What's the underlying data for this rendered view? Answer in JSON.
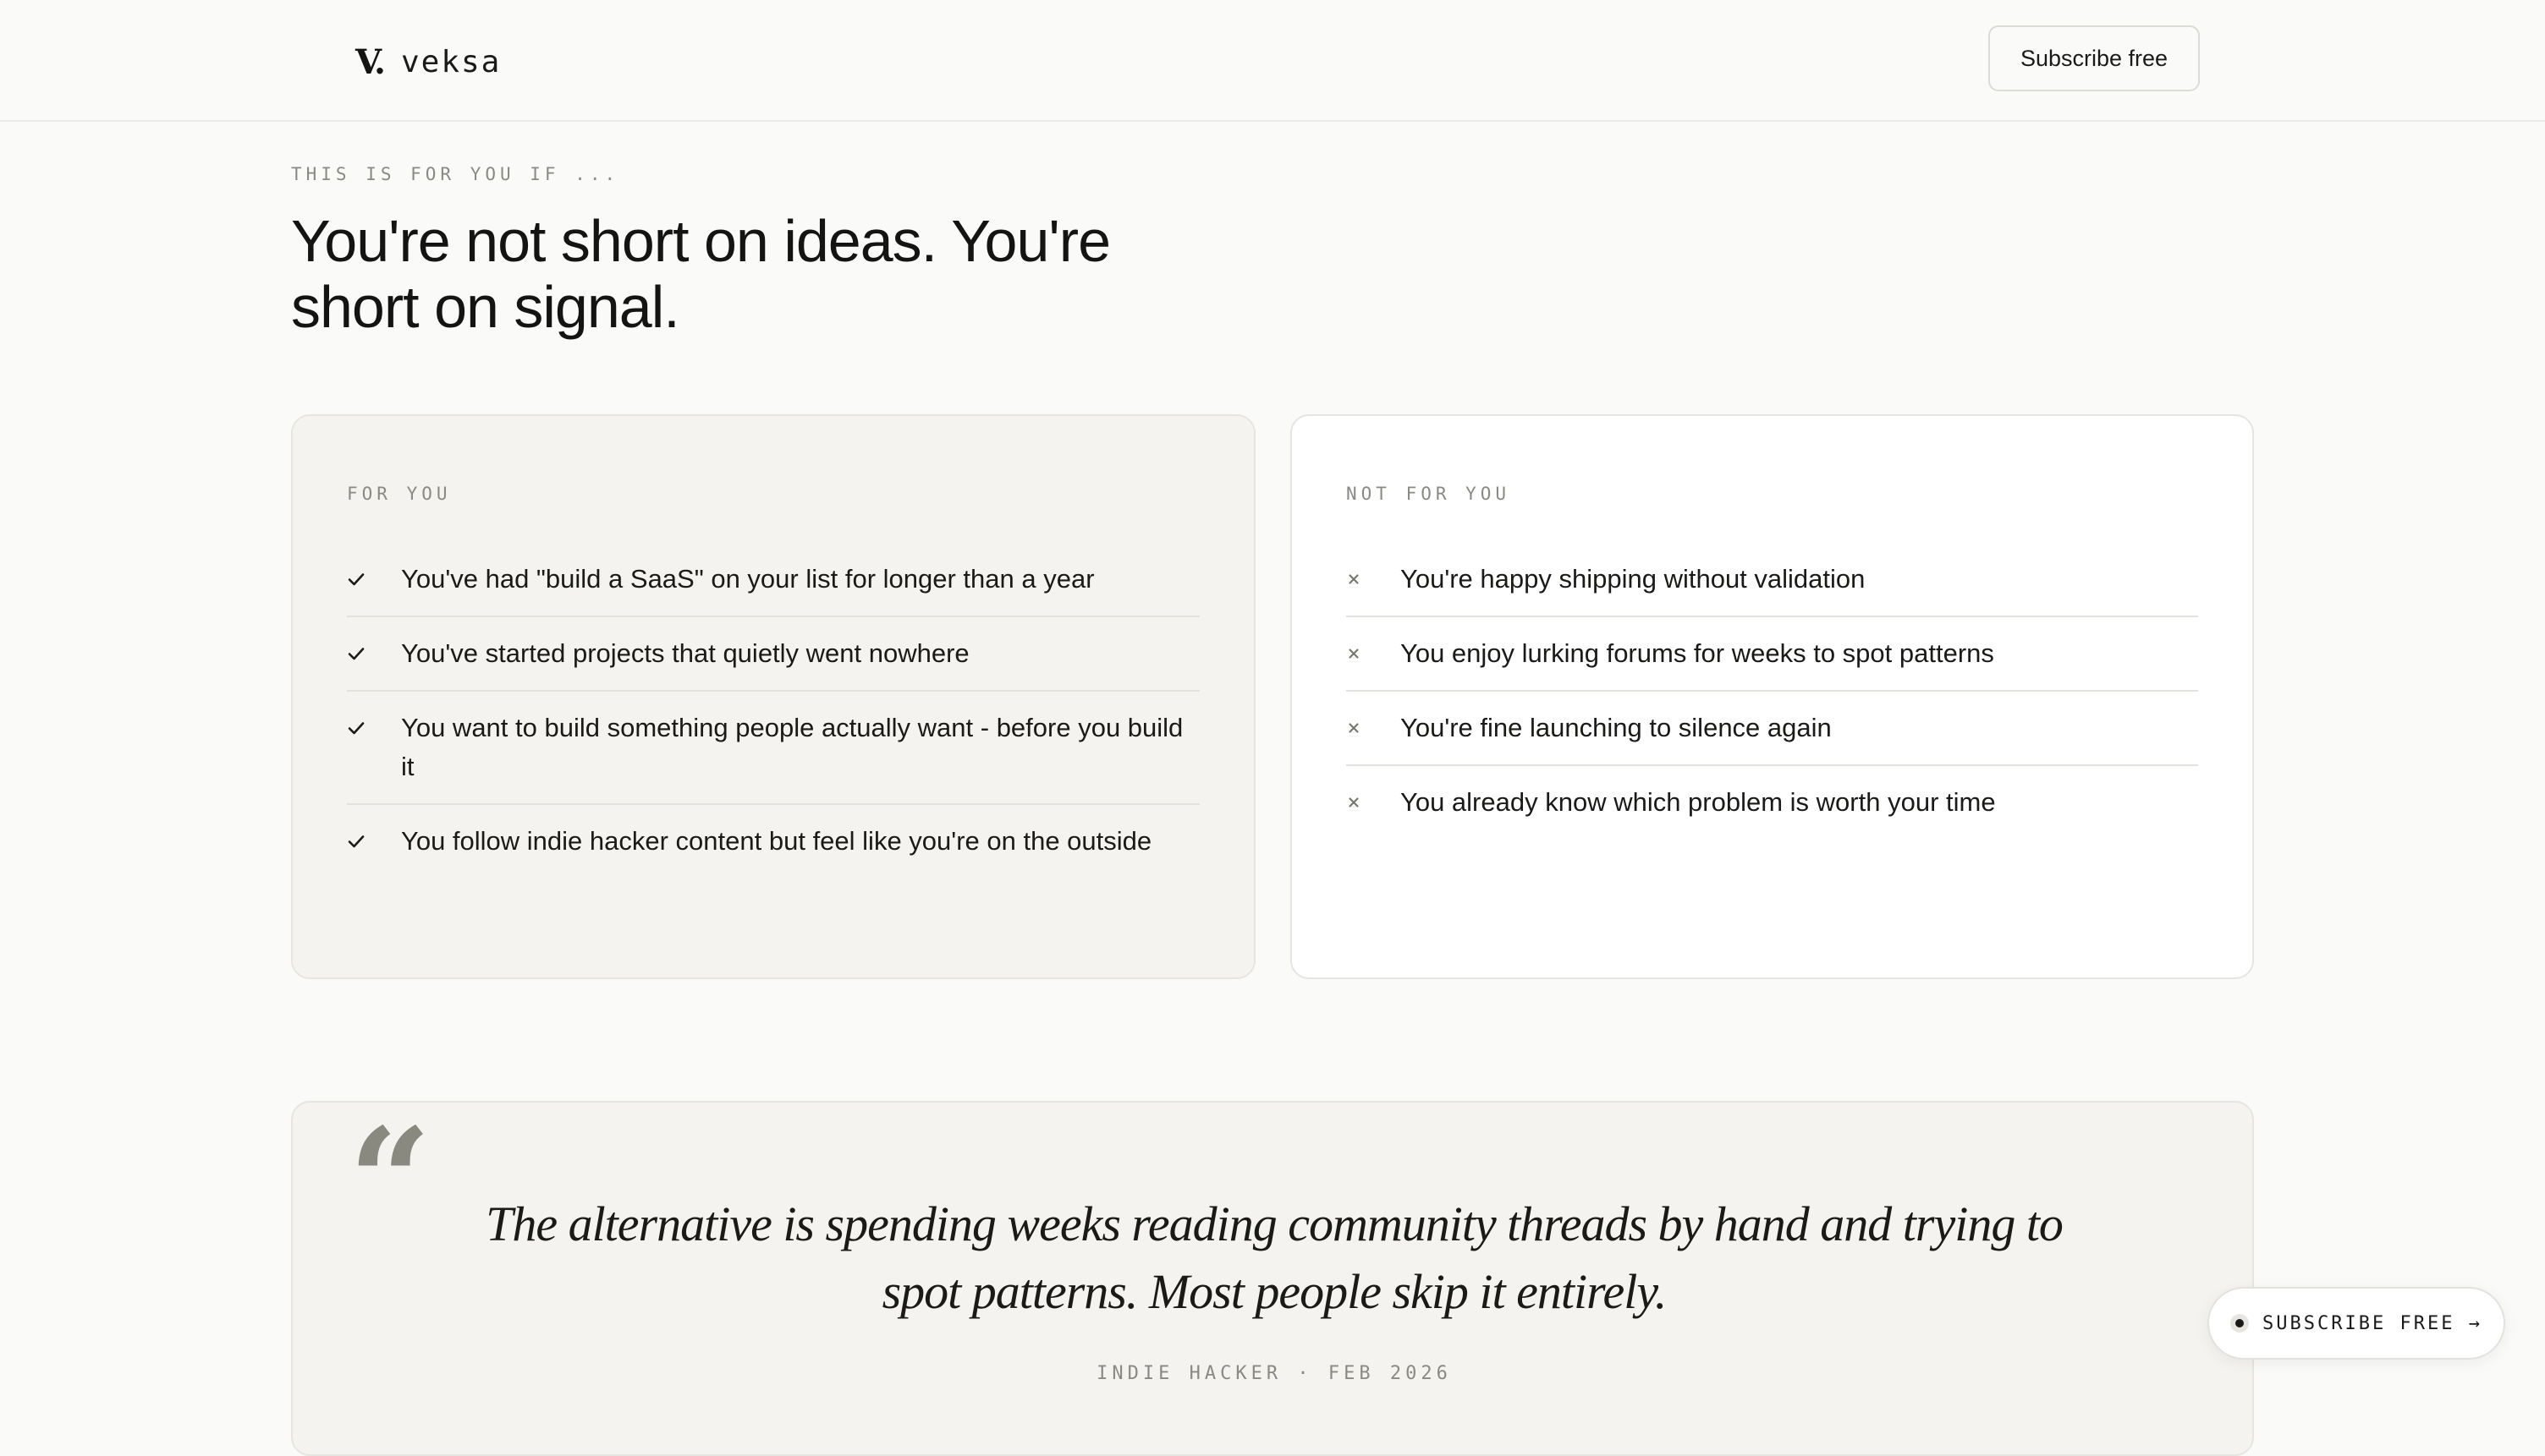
{
  "header": {
    "logo_mark": "V.",
    "logo_name": "veksa",
    "subscribe_label": "Subscribe free"
  },
  "intro": {
    "eyebrow": "THIS IS FOR YOU IF ...",
    "headline": "You're not short on ideas. You're short on signal."
  },
  "for_you": {
    "label": "FOR YOU",
    "icon": "check-icon",
    "items": [
      "You've had \"build a SaaS\" on your list for longer than a year",
      "You've started projects that quietly went nowhere",
      "You want to build something people actually want - before you build it",
      "You follow indie hacker content but feel like you're on the outside"
    ]
  },
  "not_for_you": {
    "label": "NOT FOR YOU",
    "icon": "x-icon",
    "items": [
      "You're happy shipping without validation",
      "You enjoy lurking forums for weeks to spot patterns",
      "You're fine launching to silence again",
      "You already know which problem is worth your time"
    ]
  },
  "quote": {
    "icon": "quote-icon",
    "text": "The alternative is spending weeks reading community threads by hand and trying to spot patterns. Most people skip it entirely.",
    "source": "INDIE HACKER · FEB 2026"
  },
  "floating_cta": {
    "label": "SUBSCRIBE FREE →"
  },
  "colors": {
    "background": "#fafaf8",
    "card_muted": "#f4f3ef",
    "card_white": "#ffffff",
    "text": "#1a1a18",
    "muted_text": "#8a8983"
  }
}
